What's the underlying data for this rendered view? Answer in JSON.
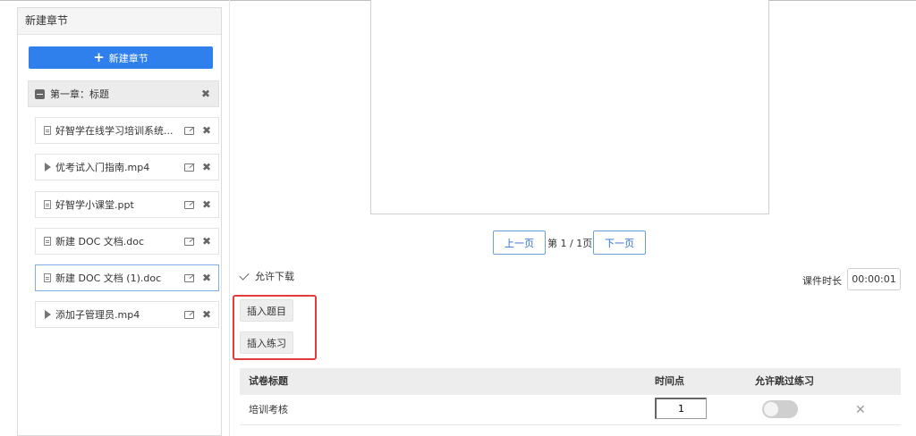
{
  "chapters_panel": {
    "title": "新建章节",
    "new_chapter_label": "新建章节",
    "chapter": {
      "label": "第一章：标题"
    },
    "lessons": [
      {
        "label": "好智学在线学习培训系统...",
        "icon": "file-icon"
      },
      {
        "label": "优考试入门指南.mp4",
        "icon": "play-icon"
      },
      {
        "label": "好智学小课堂.ppt",
        "icon": "file-icon"
      },
      {
        "label": "新建 DOC 文档.doc",
        "icon": "file-icon"
      },
      {
        "label": "新建 DOC 文档 (1).doc",
        "icon": "file-icon",
        "selected": true
      },
      {
        "label": "添加子管理员.mp4",
        "icon": "play-icon"
      }
    ]
  },
  "pager": {
    "prev_label": "上一页",
    "indicator": "第 1 / 1页",
    "next_label": "下一页"
  },
  "options": {
    "allow_download_label": "允许下载",
    "allow_download_checked": true,
    "duration_label": "课件时长",
    "duration_value": "00:00:01"
  },
  "insert": {
    "question_label": "插入题目",
    "exercise_label": "插入练习",
    "highlight_color": "#e23b3b"
  },
  "table": {
    "headers": {
      "title": "试卷标题",
      "time": "时间点",
      "skip": "允许跳过练习"
    },
    "rows": [
      {
        "title": "培训考核",
        "time": "1",
        "skip": false
      }
    ]
  },
  "colors": {
    "accent": "#2f80ed"
  }
}
